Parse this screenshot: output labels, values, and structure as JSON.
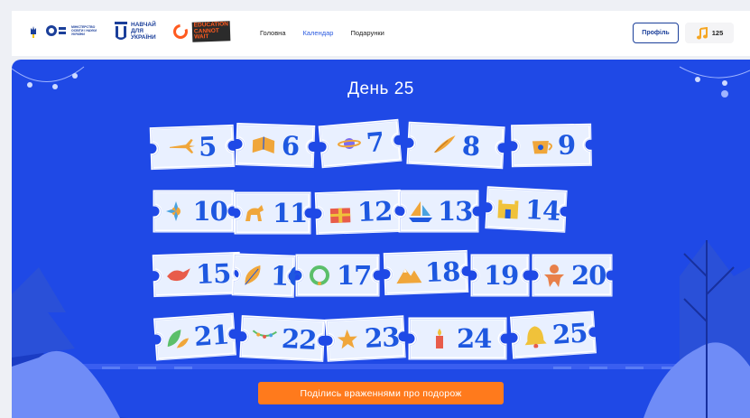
{
  "header": {
    "ministry_logo_text": "МІНІСТЕРСТВО ОСВІТИ І НАУКИ УКРАЇНИ",
    "navchai_logo_text": [
      "НАВЧАЙ",
      "ДЛЯ",
      "УКРАЇНИ"
    ],
    "ecw_logo_text": [
      "EDUCATION",
      "CANNOT",
      "WAIT"
    ],
    "nav": [
      {
        "label": "Головна",
        "active": false
      },
      {
        "label": "Календар",
        "active": true
      },
      {
        "label": "Подарунки",
        "active": false
      }
    ],
    "profile_label": "Профіль",
    "coins": "125"
  },
  "main": {
    "title": "День 25",
    "cta_label": "Поділись враженнями про подорож"
  },
  "calendar": {
    "days": [
      {
        "num": "5",
        "icon": "airplane-icon"
      },
      {
        "num": "6",
        "icon": "book-icon"
      },
      {
        "num": "7",
        "icon": "planet-icon"
      },
      {
        "num": "8",
        "icon": "quill-icon"
      },
      {
        "num": "9",
        "icon": "teapot-icon"
      },
      {
        "num": "10",
        "icon": "flower-ornament-icon"
      },
      {
        "num": "11",
        "icon": "horse-icon"
      },
      {
        "num": "12",
        "icon": "gift-icon"
      },
      {
        "num": "13",
        "icon": "sailboat-icon"
      },
      {
        "num": "14",
        "icon": "castle-icon"
      },
      {
        "num": "15",
        "icon": "dove-icon"
      },
      {
        "num": "16",
        "icon": "leaf-icon"
      },
      {
        "num": "17",
        "icon": "wreath-icon"
      },
      {
        "num": "18",
        "icon": "mountains-icon"
      },
      {
        "num": "19",
        "icon": ""
      },
      {
        "num": "20",
        "icon": "gingerbread-icon"
      },
      {
        "num": "21",
        "icon": "leaves-icon"
      },
      {
        "num": "22",
        "icon": "garland-icon"
      },
      {
        "num": "23",
        "icon": "stars-icon"
      },
      {
        "num": "24",
        "icon": "candle-icon"
      },
      {
        "num": "25",
        "icon": "bell-icon"
      }
    ]
  },
  "colors": {
    "primary_blue": "#1f49e6",
    "ticket_number": "#1e58e0",
    "cta_orange": "#ff7a1c",
    "nav_active": "#2b5be0"
  }
}
